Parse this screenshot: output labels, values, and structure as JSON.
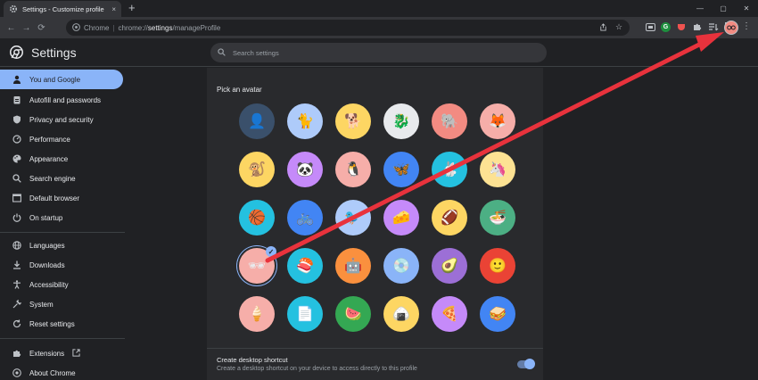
{
  "tab": {
    "title": "Settings - Customize profile",
    "close": "×"
  },
  "new_tab": "+",
  "window_controls": {
    "minimize": "—",
    "maximize": "▢",
    "close": "✕"
  },
  "toolbar": {
    "back": "←",
    "forward": "→",
    "reload": "⟳"
  },
  "omnibox": {
    "site_name": "Chrome",
    "separator": "|",
    "url_scheme": "chrome://",
    "url_host": "settings",
    "url_path": "/manageProfile"
  },
  "settings": {
    "title": "Settings",
    "search_placeholder": "Search settings"
  },
  "sidebar": {
    "items": [
      {
        "label": "You and Google",
        "icon": "person-icon",
        "active": true
      },
      {
        "label": "Autofill and passwords",
        "icon": "clipboard-icon"
      },
      {
        "label": "Privacy and security",
        "icon": "shield-icon"
      },
      {
        "label": "Performance",
        "icon": "speedometer-icon"
      },
      {
        "label": "Appearance",
        "icon": "palette-icon"
      },
      {
        "label": "Search engine",
        "icon": "search-icon"
      },
      {
        "label": "Default browser",
        "icon": "browser-icon"
      },
      {
        "label": "On startup",
        "icon": "power-icon"
      },
      {
        "label": "Languages",
        "icon": "globe-icon"
      },
      {
        "label": "Downloads",
        "icon": "download-icon"
      },
      {
        "label": "Accessibility",
        "icon": "accessibility-icon"
      },
      {
        "label": "System",
        "icon": "wrench-icon"
      },
      {
        "label": "Reset settings",
        "icon": "reset-icon"
      },
      {
        "label": "Extensions",
        "icon": "puzzle-icon"
      },
      {
        "label": "About Chrome",
        "icon": "chrome-icon"
      }
    ]
  },
  "profile": {
    "pick_avatar_label": "Pick an avatar",
    "shortcut_title": "Create desktop shortcut",
    "shortcut_desc": "Create a desktop shortcut on your device to access directly to this profile"
  },
  "avatars": [
    {
      "name": "avatar-photo",
      "bg": "#3a506b",
      "glyph": "👤"
    },
    {
      "name": "avatar-cat",
      "bg": "#aecbfa",
      "glyph": "🐈"
    },
    {
      "name": "avatar-corgi",
      "bg": "#fdd663",
      "glyph": "🐕"
    },
    {
      "name": "avatar-dragon",
      "bg": "#e8eaed",
      "glyph": "🐉"
    },
    {
      "name": "avatar-elephant",
      "bg": "#f28b82",
      "glyph": "🐘"
    },
    {
      "name": "avatar-fox",
      "bg": "#f6aea9",
      "glyph": "🦊"
    },
    {
      "name": "avatar-monkey",
      "bg": "#fdd663",
      "glyph": "🐒"
    },
    {
      "name": "avatar-panda",
      "bg": "#c58af9",
      "glyph": "🐼"
    },
    {
      "name": "avatar-penguin",
      "bg": "#f6aea9",
      "glyph": "🐧"
    },
    {
      "name": "avatar-butterfly",
      "bg": "#4285f4",
      "glyph": "🦋"
    },
    {
      "name": "avatar-rabbit",
      "bg": "#24c1e0",
      "glyph": "🐇"
    },
    {
      "name": "avatar-unicorn",
      "bg": "#fde293",
      "glyph": "🦄"
    },
    {
      "name": "avatar-basketball",
      "bg": "#24c1e0",
      "glyph": "🏀"
    },
    {
      "name": "avatar-bike",
      "bg": "#4285f4",
      "glyph": "🚲"
    },
    {
      "name": "avatar-bird",
      "bg": "#aecbfa",
      "glyph": "🐦"
    },
    {
      "name": "avatar-cheese",
      "bg": "#c58af9",
      "glyph": "🧀"
    },
    {
      "name": "avatar-football",
      "bg": "#fdd663",
      "glyph": "🏈"
    },
    {
      "name": "avatar-ramen",
      "bg": "#4caf84",
      "glyph": "🍜"
    },
    {
      "name": "avatar-sunglasses",
      "bg": "#f6aea9",
      "glyph": "🕶",
      "selected": true
    },
    {
      "name": "avatar-sushi",
      "bg": "#24c1e0",
      "glyph": "🍣"
    },
    {
      "name": "avatar-tamagotchi",
      "bg": "#fa903e",
      "glyph": "🤖"
    },
    {
      "name": "avatar-vinyl",
      "bg": "#8ab4f8",
      "glyph": "💿"
    },
    {
      "name": "avatar-avocado",
      "bg": "#9c6fd6",
      "glyph": "🥑"
    },
    {
      "name": "avatar-smile",
      "bg": "#ea4335",
      "glyph": "🙂"
    },
    {
      "name": "avatar-icecream",
      "bg": "#f6aea9",
      "glyph": "🍦"
    },
    {
      "name": "avatar-origami",
      "bg": "#24c1e0",
      "glyph": "📄"
    },
    {
      "name": "avatar-watermelon",
      "bg": "#34a853",
      "glyph": "🍉"
    },
    {
      "name": "avatar-onigiri",
      "bg": "#fdd663",
      "glyph": "🍙"
    },
    {
      "name": "avatar-pizza",
      "bg": "#c58af9",
      "glyph": "🍕"
    },
    {
      "name": "avatar-sandwich",
      "bg": "#4285f4",
      "glyph": "🥪"
    }
  ],
  "colors": {
    "accent": "#8ab4f8",
    "arrow": "#e8323c"
  }
}
